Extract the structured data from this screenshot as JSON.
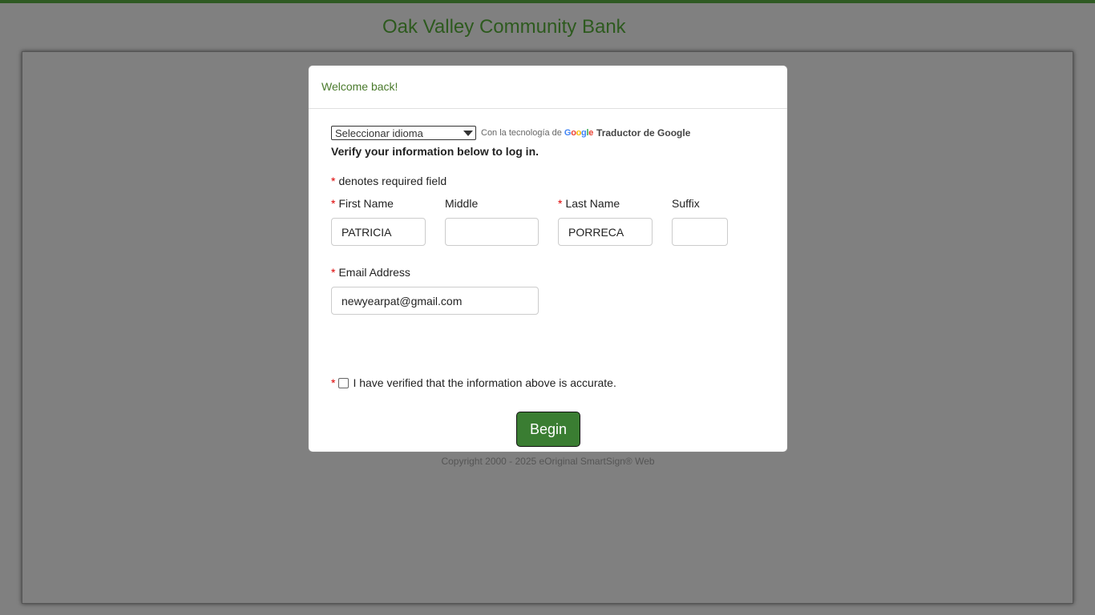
{
  "bank": {
    "name": "Oak Valley Community Bank"
  },
  "modal": {
    "welcome": "Welcome back!",
    "translate": {
      "select_value": "Seleccionar idioma",
      "powered_by": "Con la tecnología de",
      "google_letters": [
        "G",
        "o",
        "o",
        "g",
        "l",
        "e"
      ],
      "translator_name": "Traductor de Google"
    },
    "instructions": "Verify your information below to log in.",
    "required_star": "*",
    "required_note": "denotes required field",
    "fields": {
      "first_name": {
        "label": "First Name",
        "value": "PATRICIA"
      },
      "middle": {
        "label": "Middle",
        "value": ""
      },
      "last_name": {
        "label": "Last Name",
        "value": "PORRECA"
      },
      "suffix": {
        "label": "Suffix",
        "value": ""
      },
      "email": {
        "label": "Email Address",
        "value": "newyearpat@gmail.com"
      }
    },
    "verify_checkbox": {
      "label": "I have verified that the information above is accurate.",
      "checked": false
    },
    "begin_button": "Begin",
    "copyright": "Copyright 2000 - 2025 eOriginal SmartSign® Web"
  },
  "colors": {
    "brand_green": "#2d5a1e",
    "button_green": "#3a7d32",
    "backdrop": "#808080",
    "required_red": "#dd0000"
  }
}
